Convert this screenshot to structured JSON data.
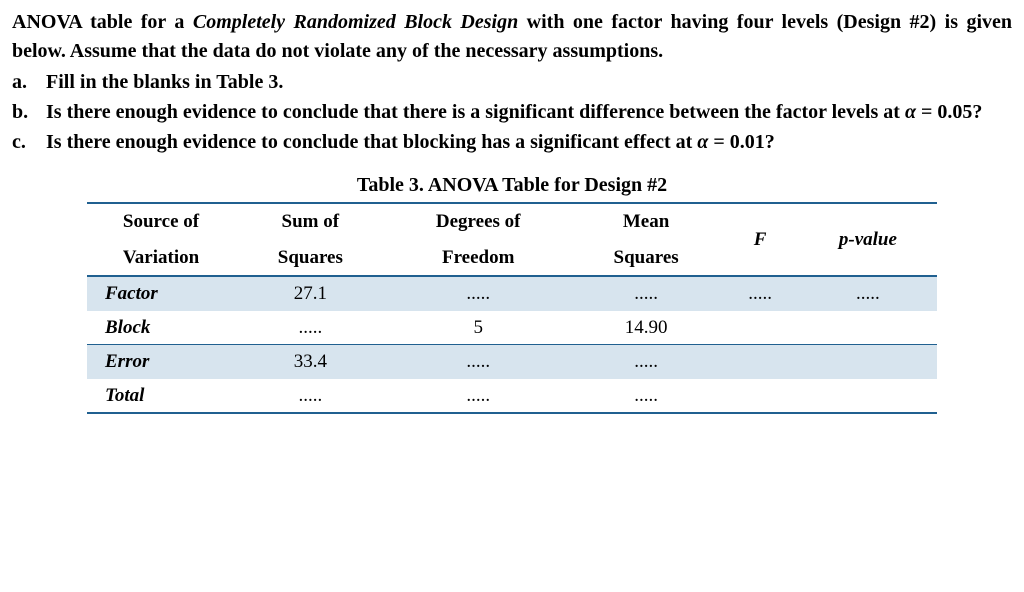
{
  "intro": {
    "part1": "ANOVA table for a ",
    "italic": "Completely Randomized Block Design",
    "part2": " with one factor having four levels (Design #2) is given below. Assume that the data do not violate any of the necessary assumptions."
  },
  "items": {
    "a": {
      "label": "a.",
      "text": "Fill in the blanks in Table 3."
    },
    "b": {
      "label": "b.",
      "text_before": "Is there enough evidence to conclude that there is a significant difference between the factor levels at ",
      "alpha": "α",
      "eq": " = 0.05?"
    },
    "c": {
      "label": "c.",
      "text_before": "Is there enough evidence to conclude that blocking has a significant effect at ",
      "alpha": "α",
      "eq": " = 0.01?"
    }
  },
  "table": {
    "title_bold": "Table 3.",
    "title_rest": " ANOVA Table for Design #2",
    "headers": {
      "source1": "Source of",
      "source2": "Variation",
      "ss1": "Sum of",
      "ss2": "Squares",
      "df1": "Degrees of",
      "df2": "Freedom",
      "ms1": "Mean",
      "ms2": "Squares",
      "F": "F",
      "p": "p-value"
    },
    "rows": {
      "factor": {
        "label": "Factor",
        "ss": "27.1",
        "df": ".....",
        "ms": ".....",
        "F": ".....",
        "p": "....."
      },
      "block": {
        "label": "Block",
        "ss": ".....",
        "df": "5",
        "ms": "14.90",
        "F": "",
        "p": ""
      },
      "error": {
        "label": "Error",
        "ss": "33.4",
        "df": ".....",
        "ms": ".....",
        "F": "",
        "p": ""
      },
      "total": {
        "label": "Total",
        "ss": ".....",
        "df": ".....",
        "ms": ".....",
        "F": "",
        "p": ""
      }
    }
  }
}
